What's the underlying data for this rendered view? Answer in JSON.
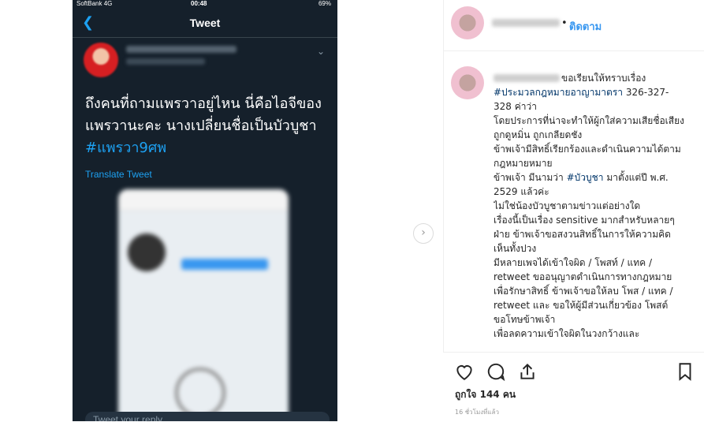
{
  "tweet": {
    "status": {
      "carrier": "SoftBank 4G",
      "time": "00:48",
      "battery": "69%"
    },
    "title": "Tweet",
    "text_main": "ถึงคนที่ถามแพรวาอยู่ไหน นี่คือไอจีของแพรวานะคะ นางเปลี่ยนชื่อเป็นบัวบูชา",
    "hashtag": "#แพรวา9ศพ",
    "translate_label": "Translate Tweet",
    "reply_placeholder": "Tweet your reply"
  },
  "instagram": {
    "follow_label": "ติดตาม",
    "caption_lead": "ขอเรียนให้ทราบเรื่อง",
    "caption_tag1": "#ประมวลกฎหมายอาญามาตรา",
    "caption_part2": " 326-327-328 ค่าว่า\nโดยประการที่น่าจะทำให้ผู้กใส่ความเสียชื่อเสียง\nถูกดูหมิ่น ถูกเกลียดชัง\nข้าพเจ้ามีสิทธิ์เรียกร้องและดำเนินความได้ตามกฎหมายหมาย\nข้าพเจ้า มีนามว่า ",
    "caption_tag2": "#บัวบูชา",
    "caption_part3": " มาตั้งแต่ปี พ.ศ. 2529 แล้วค่ะ\nไม่ใช่น้องบัวบูชาตามข่าวแต่อย่างใด\nเรื่องนี้เป็นเรื่อง sensitive มากสำหรับหลายๆฝ่าย ข้าพเจ้าขอสงวนสิทธิ์ในการให้ความคิดเห็นทั้งปวง\nมีหลายเพจได้เข้าใจผิด / โพสท์ / แทค / retweet ขออนุญาตดำเนินการทางกฎหมาย เพื่อรักษาสิทธิ์ ข้าพเจ้าขอให้ลบ โพส / แทค / retweet และ ขอให้ผู้มีส่วนเกี่ยวข้อง โพสต์ขอโทษข้าพเจ้า\nเพื่อลดความเข้าใจผิดในวงกว้างและ",
    "likes": "ถูกใจ 144 คน",
    "time_ago": "16 ชั่วโมงที่แล้ว",
    "icons": [
      "heart-icon",
      "comment-icon",
      "share-icon",
      "bookmark-icon",
      "chevron-right-icon"
    ]
  },
  "colors": {
    "twitter_bg": "#15202b",
    "twitter_blue": "#1da1f2",
    "ig_blue": "#3897f0"
  }
}
